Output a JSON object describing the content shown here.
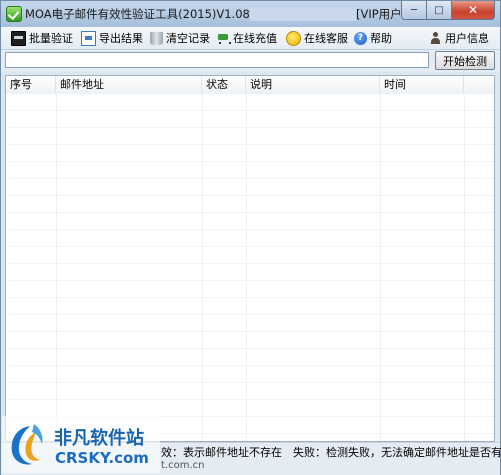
{
  "window": {
    "title": "MOA电子邮件有效性验证工具(2015)V1.08",
    "title_suffix": "[VIP用户]",
    "controls": {
      "minimize": "─",
      "maximize": "□",
      "close": "✕"
    }
  },
  "toolbar": {
    "batch_verify": "批量验证",
    "export": "导出结果",
    "clear": "清空记录",
    "recharge": "在线充值",
    "support": "在线客服",
    "help": "帮助",
    "user_info": "用户信息"
  },
  "input": {
    "value": "",
    "start_button": "开始检测"
  },
  "table": {
    "columns": [
      "序号",
      "邮件地址",
      "状态",
      "说明",
      "时间"
    ]
  },
  "status": {
    "text": "效：表示邮件地址不存在　失败：检测失败，无法确定邮件地址是否有效",
    "sub": "t.com.cn"
  },
  "watermark": {
    "cn": "非凡软件站",
    "en": "CRSKY.com"
  }
}
